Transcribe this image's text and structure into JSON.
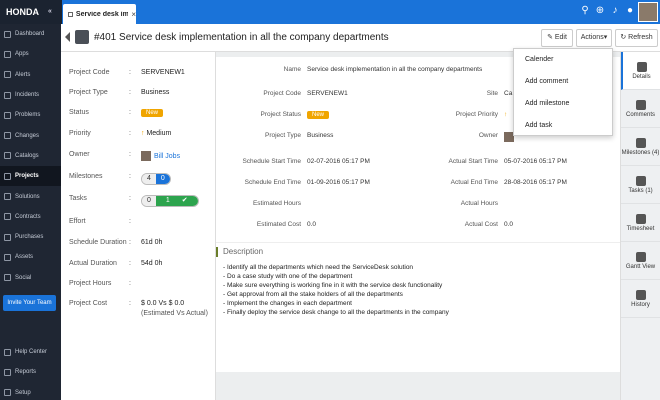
{
  "app": {
    "brand": "HONDA"
  },
  "tab": {
    "label": "Service desk imple..."
  },
  "sidebar": {
    "items": [
      "Dashboard",
      "Apps",
      "Alerts",
      "Incidents",
      "Problems",
      "Changes",
      "Catalogs",
      "Projects",
      "Solutions",
      "Contracts",
      "Purchases",
      "Assets",
      "Social"
    ],
    "active": "Projects",
    "invite": "Invite Your Team",
    "bottom": [
      "Help Center",
      "Reports",
      "Setup"
    ]
  },
  "header": {
    "title": "#401 Service desk implementation in all the company departments",
    "edit": "Edit",
    "actions": "Actions",
    "refresh": "Refresh"
  },
  "info": {
    "rows": [
      {
        "label": "Project Code",
        "value": "SERVENEW1"
      },
      {
        "label": "Project Type",
        "value": "Business"
      },
      {
        "label": "Status",
        "value": "New"
      },
      {
        "label": "Priority",
        "value": "Medium"
      },
      {
        "label": "Owner",
        "value": "Bill Jobs"
      },
      {
        "label": "Milestones",
        "value": ""
      },
      {
        "label": "Tasks",
        "value": ""
      },
      {
        "label": "Effort",
        "value": ""
      },
      {
        "label": "Schedule Duration",
        "value": "61d 0h"
      },
      {
        "label": "Actual Duration",
        "value": "54d 0h"
      },
      {
        "label": "Project Hours",
        "value": ""
      },
      {
        "label": "Project Cost",
        "value": "$ 0.0  Vs  $ 0.0"
      }
    ],
    "cost_note": "(Estimated Vs Actual)",
    "milestones": [
      "4",
      "0"
    ],
    "tasks": [
      "0",
      "1"
    ]
  },
  "detail": {
    "name_label": "Name",
    "name": "Service desk implementation in all the company departments",
    "code_label": "Project Code",
    "code": "SERVENEW1",
    "site_label": "Site",
    "site": "Ca",
    "status_label": "Project Status",
    "status": "New",
    "priority_label": "Project Priority",
    "type_label": "Project Type",
    "type": "Business",
    "owner_label": "Owner",
    "sched_start_label": "Schedule Start Time",
    "sched_start": "02-07-2016 05:17 PM",
    "actual_start_label": "Actual Start Time",
    "actual_start": "05-07-2016 05:17 PM",
    "sched_end_label": "Schedule End Time",
    "sched_end": "01-09-2016 05:17 PM",
    "actual_end_label": "Actual End Time",
    "actual_end": "28-08-2016 05:17 PM",
    "est_hours_label": "Estimated Hours",
    "act_hours_label": "Actual Hours",
    "est_cost_label": "Estimated Cost",
    "est_cost": "0.0",
    "act_cost_label": "Actual Cost",
    "act_cost": "0.0"
  },
  "description": {
    "heading": "Description",
    "lines": [
      "- Identify all the departments which need the ServiceDesk solution",
      "- Do a case study with one of the department",
      "- Make sure everything is working fine in it with the service desk functionality",
      "- Get approval from all the stake holders of all the departments",
      "- Implement the changes in each department",
      "- Finally deploy the service desk change to all the departments in the company"
    ]
  },
  "rail": [
    {
      "label": "Details"
    },
    {
      "label": "Comments"
    },
    {
      "label": "Milestones (4)"
    },
    {
      "label": "Tasks (1)"
    },
    {
      "label": "Timesheet"
    },
    {
      "label": "Gantt View"
    },
    {
      "label": "History"
    }
  ],
  "dropdown": [
    "Calender",
    "Add comment",
    "Add milestone",
    "Add task"
  ],
  "colors": {
    "accent": "#1a73d9",
    "sidebar": "#1f2633",
    "new_badge": "#f0a500",
    "done": "#2da44e"
  }
}
